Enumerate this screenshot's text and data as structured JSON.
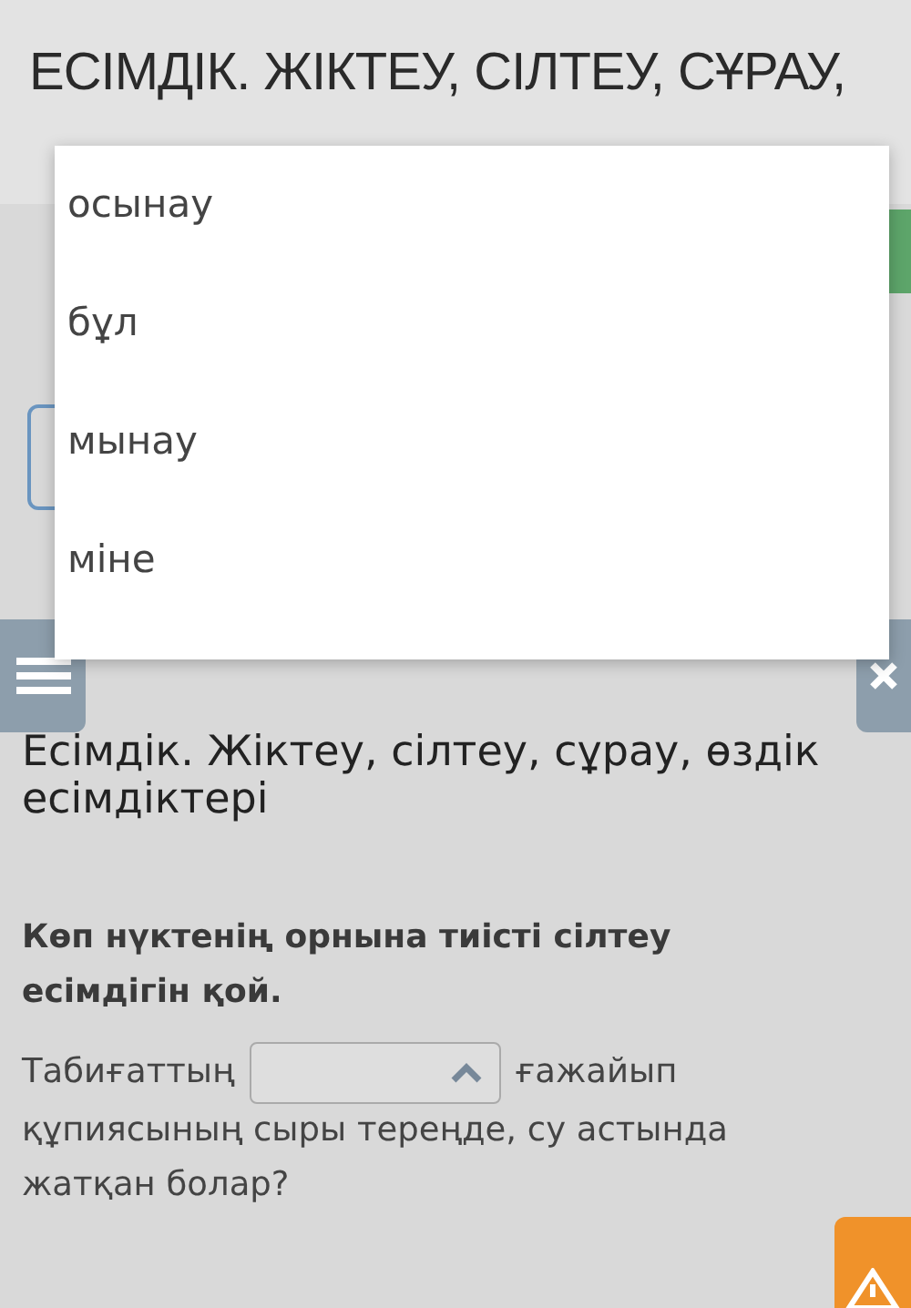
{
  "header": {
    "title": "ЕСІМДІК. ЖІКТЕУ, СІЛТЕУ, СҰРАУ,"
  },
  "dropdown": {
    "open": true,
    "options": [
      {
        "label": "осынау",
        "selected": false
      },
      {
        "label": "бұл",
        "selected": false
      },
      {
        "label": "мынау",
        "selected": false
      },
      {
        "label": "міне",
        "selected": false
      }
    ]
  },
  "lesson": {
    "heading": "Есімдік. Жіктеу, сілтеу, сұрау, өздік есімдіктері",
    "instruction": "Көп нүктенің орнына тиісті сілтеу есімдігін қой.",
    "sentence": {
      "before": "Табиғаттың",
      "after": "ғажайып",
      "continuation": "құпиясының сыры тереңде, су астында жатқан болар?",
      "select": {
        "expanded": true
      }
    }
  }
}
